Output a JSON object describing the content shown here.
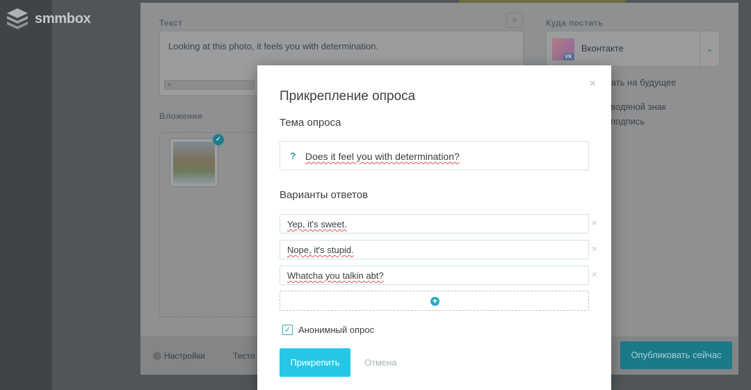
{
  "app": {
    "logo_text": "smmbox"
  },
  "editor": {
    "text_label": "Текст",
    "text_value": "Looking at this photo, it feels you with determination.",
    "hash_button": "#",
    "scroll_left": "<",
    "attachments_label": "Вложения",
    "attachment_check": "✓",
    "destination_label": "Куда постить",
    "destination_name": "Вконтакте",
    "destination_badge": "VK",
    "destination_arrow": "⌄",
    "option_schedule": "вать на будущее",
    "option_watermark": "водяной знак",
    "option_signature": "подпись",
    "settings_label": "Настройки",
    "test_label": "Тесто",
    "publish_button": "Опубликовать сейчас"
  },
  "modal": {
    "title": "Прикрепление опроса",
    "close_icon": "×",
    "topic_label": "Тема опроса",
    "topic_prefix": "?",
    "topic_value": "Does it feel you with determination?",
    "answers_label": "Варианты ответов",
    "answers": [
      {
        "value": "Yep, it's sweet.",
        "remove": "×"
      },
      {
        "value": "Nope, it's stupid.",
        "remove": "×"
      },
      {
        "value": "Whatcha you talkin abt?",
        "remove": "×"
      }
    ],
    "add_icon": "+",
    "anonymous_checked": true,
    "anonymous_check": "✓",
    "anonymous_label": "Анонимный опрос",
    "attach_button": "Прикрепить",
    "cancel_link": "Отмена"
  },
  "colors": {
    "accent": "#26c6e6",
    "accent_dark": "#2fa9bf",
    "overlay": "#505558"
  }
}
